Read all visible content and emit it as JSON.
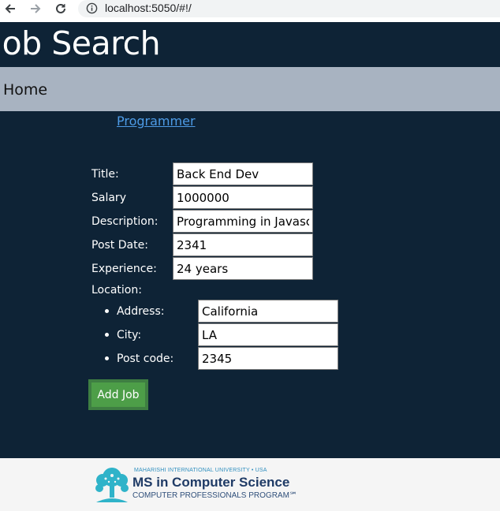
{
  "browser": {
    "url": "localhost:5050/#!/"
  },
  "header": {
    "title": "Job Search"
  },
  "nav": {
    "home_label": "Home"
  },
  "job": {
    "link_label": "Programmer"
  },
  "form": {
    "title_label": "Title:",
    "title_value": "Back End Dev",
    "salary_label": "Salary",
    "salary_value": "1000000",
    "description_label": "Description:",
    "description_value": "Programming in Javascri",
    "post_date_label": "Post Date:",
    "post_date_value": "2341",
    "experience_label": "Experience:",
    "experience_value": "24 years",
    "location_label": "Location:",
    "address_label": "Address:",
    "address_value": "California",
    "city_label": "City:",
    "city_value": "LA",
    "post_code_label": "Post code:",
    "post_code_value": "2345",
    "add_button_label": "Add Job"
  },
  "footer": {
    "line1": "MAHARISHI INTERNATIONAL UNIVERSITY • USA",
    "line2": "MS in Computer Science",
    "line3": "COMPUTER PROFESSIONALS PROGRAM℠"
  },
  "colors": {
    "background": "#0e2336",
    "navbar": "#a8b3c1",
    "link": "#4d9be6",
    "button": "#4d9e48",
    "footer": "#f5f5f5"
  },
  "icons": [
    "back-arrow-icon",
    "forward-arrow-icon",
    "reload-icon",
    "info-icon",
    "tree-logo-icon"
  ]
}
